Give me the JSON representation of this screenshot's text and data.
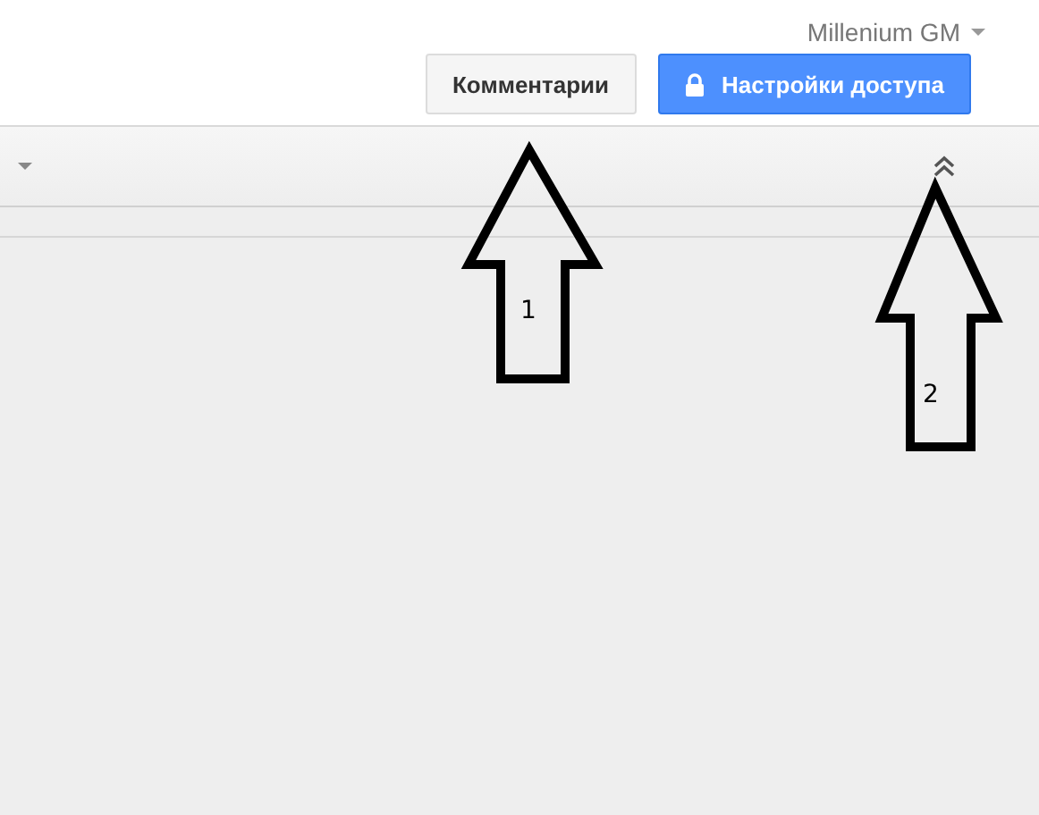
{
  "account": {
    "name": "Millenium GM"
  },
  "buttons": [
    {
      "kind": "plain",
      "label": "Комментарии"
    },
    {
      "kind": "share",
      "label": "Настройки доступа"
    }
  ],
  "annotations": [
    {
      "label": "1"
    },
    {
      "label": "2"
    }
  ]
}
